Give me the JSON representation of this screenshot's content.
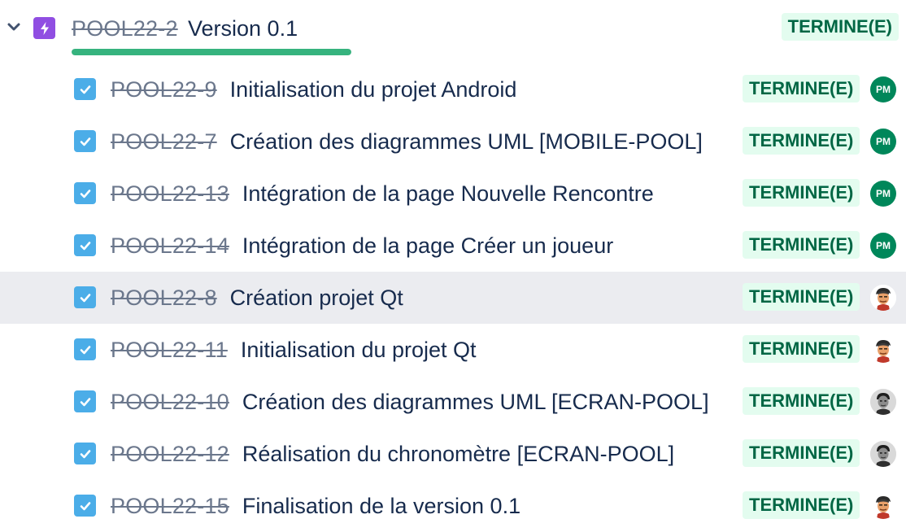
{
  "epic": {
    "key": "POOL22-2",
    "title": "Version 0.1",
    "status": "TERMINE(E)",
    "progress": 1.0,
    "icon": "lightning-icon",
    "colors": {
      "icon_bg": "#904ee2",
      "progress": "#36b37e"
    }
  },
  "issues": [
    {
      "key": "POOL22-9",
      "summary": "Initialisation du projet Android",
      "status": "TERMINE(E)",
      "assignee": {
        "type": "initials",
        "initials": "PM"
      }
    },
    {
      "key": "POOL22-7",
      "summary": "Création des diagrammes UML [MOBILE-POOL]",
      "status": "TERMINE(E)",
      "assignee": {
        "type": "initials",
        "initials": "PM"
      }
    },
    {
      "key": "POOL22-13",
      "summary": "Intégration de la page Nouvelle Rencontre",
      "status": "TERMINE(E)",
      "assignee": {
        "type": "initials",
        "initials": "PM"
      }
    },
    {
      "key": "POOL22-14",
      "summary": "Intégration de la page Créer un joueur",
      "status": "TERMINE(E)",
      "assignee": {
        "type": "initials",
        "initials": "PM"
      }
    },
    {
      "key": "POOL22-8",
      "summary": "Création projet Qt",
      "status": "TERMINE(E)",
      "assignee": {
        "type": "photo-a"
      }
    },
    {
      "key": "POOL22-11",
      "summary": "Initialisation du projet Qt",
      "status": "TERMINE(E)",
      "assignee": {
        "type": "photo-a"
      }
    },
    {
      "key": "POOL22-10",
      "summary": "Création des diagrammes UML [ECRAN-POOL]",
      "status": "TERMINE(E)",
      "assignee": {
        "type": "photo-b"
      }
    },
    {
      "key": "POOL22-12",
      "summary": "Réalisation du chronomètre [ECRAN-POOL]",
      "status": "TERMINE(E)",
      "assignee": {
        "type": "photo-b"
      }
    },
    {
      "key": "POOL22-15",
      "summary": "Finalisation de la version 0.1",
      "status": "TERMINE(E)",
      "assignee": {
        "type": "photo-a"
      }
    }
  ],
  "highlighted_issue": "POOL22-8",
  "colors": {
    "checkbox": "#4bade8",
    "status_bg": "#e3fcef",
    "status_text": "#006644",
    "key_text": "#6b778c",
    "summary_text": "#172b4d",
    "highlight_row": "#ebecf0",
    "initials_avatar": "#00875a"
  }
}
